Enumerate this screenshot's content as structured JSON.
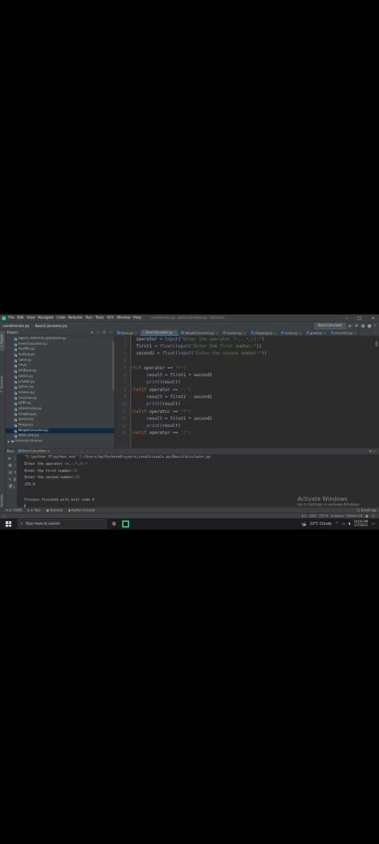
{
  "titlebar": {
    "menu": [
      "File",
      "Edit",
      "View",
      "Navigate",
      "Code",
      "Refactor",
      "Run",
      "Tools",
      "VCS",
      "Window",
      "Help"
    ],
    "title": "conditionals.py - BasicCalculator.py - PyCharm"
  },
  "navbar": {
    "project": "conditionals.py",
    "file": "BasicCalculator.py",
    "run_config": "BasicCalculator"
  },
  "project_pane": {
    "title": "Project",
    "files": [
      "logical_relational_operations.py",
      "loversCalculator.py",
      "maxMin.py",
      "multiply.py",
      "name.py",
      "nw.py",
      "OddEven.py",
      "oddish.py",
      "printMe.py",
      "python.py",
      "recaess.py",
      "recursion.py",
      "rollfiir.py",
      "rollerdcoster.py",
      "shopping.py",
      "special.py",
      "Steppy.py",
      "WeightConverter.py",
      "while_loop.py"
    ],
    "selected_index": 17,
    "external": "External Libraries"
  },
  "left_strip": {
    "project_label": "1: Project",
    "structure_label": "7: Structure",
    "favorites_label": "2: Favorites"
  },
  "editor": {
    "tabs": [
      {
        "label": "types.py",
        "active": false
      },
      {
        "label": "BasicCalculator.py",
        "active": true
      },
      {
        "label": "WeightConverter.py",
        "active": false
      },
      {
        "label": "recaess.py",
        "active": false
      },
      {
        "label": "shopping.py",
        "active": false
      },
      {
        "label": "name.py",
        "active": false
      },
      {
        "label": "greet.py",
        "active": false
      },
      {
        "label": "recursion.py",
        "active": false
      }
    ],
    "line_numbers": [
      "1",
      "2",
      "3",
      "4",
      "5",
      "6",
      "7",
      "8",
      "9",
      "10",
      "11",
      "12",
      "13",
      "14"
    ]
  },
  "run_panel": {
    "label": "Run:",
    "config": "BasicCalculator",
    "command": "\"C:\\python 37\\python.exe\" C:/Users/hp/PycharmProjects/conditionals.py/BasicCalculator.py",
    "prompt1": "Enter the operator (+,-,*,/):",
    "input1": "*",
    "prompt2": "Enter the first number:",
    "input2": "15",
    "prompt3": "Enter the second number:",
    "input3": "15",
    "result": "225.0",
    "finish": "Process finished with exit code 0"
  },
  "watermark": {
    "line1": "Activate Windows",
    "line2": "Go to Settings to activate Windows."
  },
  "bottom_tabs": [
    "6: TODO",
    "4: Run",
    "Terminal",
    "Python Console"
  ],
  "event_log": "Event Log",
  "status": {
    "position": "8:1",
    "line_sep": "CRLF",
    "encoding": "UTF-8",
    "indent": "4 spaces",
    "interpreter": "Python 3.8"
  },
  "taskbar": {
    "search_placeholder": "Type here to search",
    "weather": "22°C  Cloudy",
    "time": "10:04 PM",
    "date": "1/7/2023"
  },
  "colors": {
    "keyword": "#cc7832",
    "string": "#6a8759",
    "builtin": "#8888c6",
    "user_input": "#59a869"
  }
}
